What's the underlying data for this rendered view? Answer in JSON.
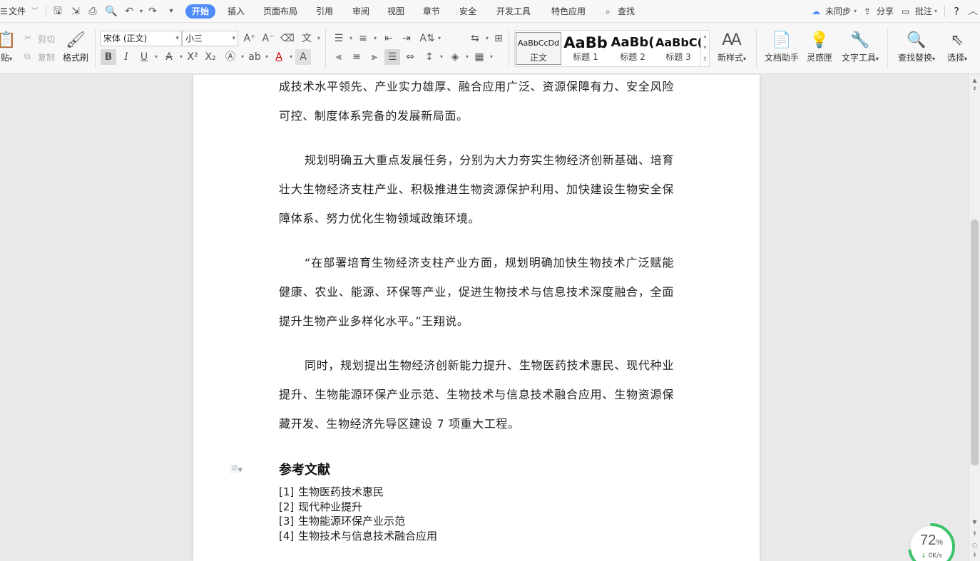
{
  "menubar": {
    "file_menu": "文件",
    "tabs": [
      "开始",
      "插入",
      "页面布局",
      "引用",
      "审阅",
      "视图",
      "章节",
      "安全",
      "开发工具",
      "特色应用"
    ],
    "search": "查找",
    "sync_status": "未同步",
    "share": "分享",
    "comment": "批注",
    "help": "?"
  },
  "ribbon": {
    "paste": "贴",
    "cut": "剪切",
    "copy": "复制",
    "format_painter": "格式刷",
    "font_name": "宋体 (正文)",
    "font_size": "小三",
    "styles": [
      {
        "preview": "AaBbCcDd",
        "name": "正文"
      },
      {
        "preview": "AaBb",
        "name": "标题 1"
      },
      {
        "preview": "AaBb(",
        "name": "标题 2"
      },
      {
        "preview": "AaBbC(",
        "name": "标题 3"
      }
    ],
    "new_style": "新样式",
    "doc_assistant": "文档助手",
    "inspiration": "灵感匣",
    "text_tools": "文字工具",
    "find_replace": "查找替换",
    "select": "选择"
  },
  "document": {
    "paragraphs": [
      "成技术水平领先、产业实力雄厚、融合应用广泛、资源保障有力、安全风险可控、制度体系完备的发展新局面。",
      "规划明确五大重点发展任务，分别为大力夯实生物经济创新基础、培育壮大生物经济支柱产业、积极推进生物资源保护利用、加快建设生物安全保障体系、努力优化生物领域政策环境。",
      "“在部署培育生物经济支柱产业方面，规划明确加快生物技术广泛赋能健康、农业、能源、环保等产业，促进生物技术与信息技术深度融合，全面提升生物产业多样化水平。”王翔说。",
      "同时，规划提出生物经济创新能力提升、生物医药技术惠民、现代种业提升、生物能源环保产业示范、生物技术与信息技术融合应用、生物资源保藏开发、生物经济先导区建设 7 项重大工程。"
    ],
    "references_heading": "参考文献",
    "references": [
      {
        "num": "[1]",
        "text": "生物医药技术惠民"
      },
      {
        "num": "[2]",
        "text": "现代种业提升"
      },
      {
        "num": "[3]",
        "text": "生物能源环保产业示范"
      },
      {
        "num": "[4]",
        "text": "生物技术与信息技术融合应用"
      }
    ]
  },
  "speed_widget": {
    "percent": "72",
    "percent_sign": "%",
    "rate": "0K/s",
    "ring_color": "#3cc36a"
  }
}
